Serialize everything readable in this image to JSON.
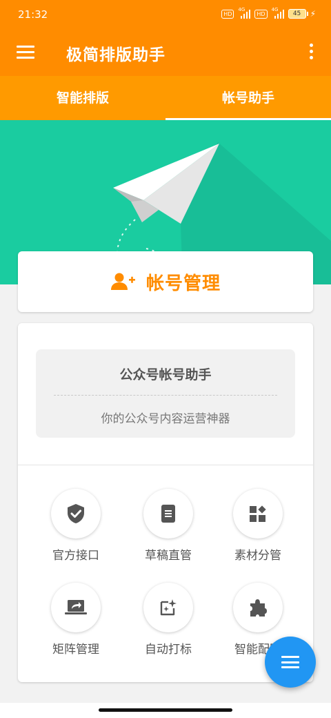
{
  "status": {
    "time": "21:32",
    "hd1": "HD",
    "net1": "4G",
    "hd2": "HD",
    "net2": "4G",
    "battery": "45"
  },
  "appbar": {
    "title": "极简排版助手"
  },
  "tabs": [
    {
      "label": "智能排版"
    },
    {
      "label": "帐号助手"
    }
  ],
  "account": {
    "title": "帐号管理"
  },
  "intro": {
    "title": "公众号帐号助手",
    "subtitle": "你的公众号内容运营神器"
  },
  "features": [
    {
      "label": "官方接口",
      "icon": "shield-check-icon"
    },
    {
      "label": "草稿直管",
      "icon": "document-icon"
    },
    {
      "label": "素材分管",
      "icon": "widgets-icon"
    },
    {
      "label": "矩阵管理",
      "icon": "laptop-share-icon"
    },
    {
      "label": "自动打标",
      "icon": "auto-fix-icon"
    },
    {
      "label": "智能配图",
      "icon": "extension-icon"
    }
  ],
  "colors": {
    "primary": "#ff8c00",
    "tabbar": "#ff9a00",
    "hero": "#1acca0",
    "fab": "#2196f3",
    "icon_gray": "#555555"
  }
}
